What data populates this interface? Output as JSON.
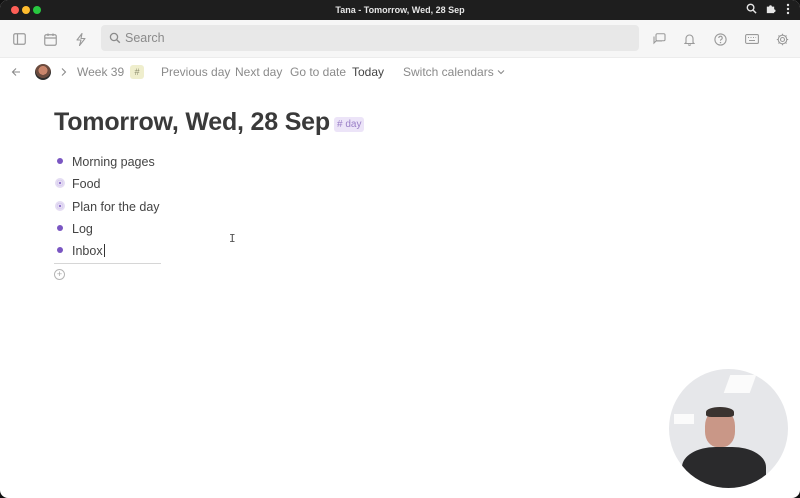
{
  "window": {
    "title": "Tana - Tomorrow, Wed, 28 Sep"
  },
  "toolbar": {
    "search_placeholder": "Search"
  },
  "nav": {
    "week_label": "Week 39",
    "week_tag": "#",
    "previous_day": "Previous day",
    "next_day": "Next day",
    "go_to_date": "Go to date",
    "today": "Today",
    "switch_calendars": "Switch calendars"
  },
  "page": {
    "title": "Tomorrow, Wed, 28 Sep",
    "tag": "# day",
    "nodes": [
      {
        "label": "Morning pages",
        "bullet": "plain"
      },
      {
        "label": "Food",
        "bullet": "ring"
      },
      {
        "label": "Plan for the day",
        "bullet": "ring"
      },
      {
        "label": "Log",
        "bullet": "plain"
      },
      {
        "label": "Inbox",
        "bullet": "plain",
        "editing": true
      }
    ]
  },
  "colors": {
    "bullet": "#7a56c2",
    "tag_bg": "#ece4f8",
    "tag_text": "#9a7fc7"
  },
  "icons": {
    "sidebar": "sidebar-toggle-icon",
    "calendar": "calendar-icon",
    "lightning": "lightning-icon",
    "search": "search-icon",
    "chat": "chat-icon",
    "bell": "bell-icon",
    "help": "help-icon",
    "keyboard": "keyboard-icon",
    "settings": "gear-icon"
  }
}
